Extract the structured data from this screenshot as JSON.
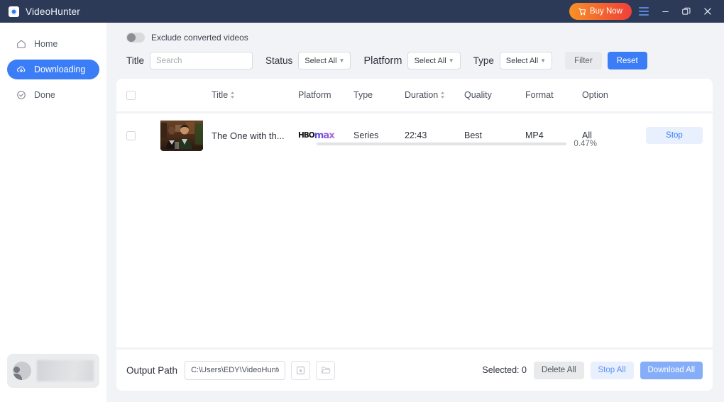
{
  "titlebar": {
    "app_name": "VideoHunter",
    "logo_icon": "videohunter-logo-icon",
    "buy_now_label": "Buy Now",
    "cart_icon": "shopping-cart-icon",
    "menu_icon": "hamburger-menu-icon",
    "minimize_icon": "minimize-icon",
    "maximize_icon": "maximize-restore-icon",
    "close_icon": "close-icon",
    "bg_color": "#2c3a57",
    "buy_now_gradient_from": "#f79127",
    "buy_now_gradient_to": "#ef3f3a"
  },
  "sidebar": {
    "items": [
      {
        "label": "Home",
        "icon": "home-icon",
        "active": false
      },
      {
        "label": "Downloading",
        "icon": "download-cloud-icon",
        "active": true
      },
      {
        "label": "Done",
        "icon": "check-circle-icon",
        "active": false
      }
    ],
    "active_color": "#3b7df6",
    "account": {
      "avatar_icon": "user-avatar-icon",
      "name_redacted": true
    }
  },
  "toolbar": {
    "exclude_toggle_label": "Exclude converted videos",
    "exclude_toggle_on": false,
    "title_label": "Title",
    "search_placeholder": "Search",
    "search_value": "",
    "status_label": "Status",
    "status_value": "Select All",
    "platform_label": "Platform",
    "platform_value": "Select All",
    "type_label": "Type",
    "type_value": "Select All",
    "filter_label": "Filter",
    "reset_label": "Reset",
    "reset_color": "#3b7df6"
  },
  "table": {
    "headers": {
      "title": "Title",
      "platform": "Platform",
      "type": "Type",
      "duration": "Duration",
      "quality": "Quality",
      "format": "Format",
      "option": "Option"
    },
    "sortable_columns": [
      "Title",
      "Duration"
    ],
    "select_all_checked": false,
    "rows": [
      {
        "checked": false,
        "thumbnail_alt": "friends-episode-thumbnail",
        "title": "The One with th...",
        "platform": "HBO max",
        "platform_brand_prefix": "HBO",
        "platform_brand_suffix": "max",
        "type": "Series",
        "duration": "22:43",
        "quality": "Best",
        "format": "MP4",
        "option": "All",
        "progress_percent": "0.47%",
        "progress_value": 0.47,
        "action_label": "Stop"
      }
    ]
  },
  "bottom": {
    "output_path_label": "Output Path",
    "output_path_value": "C:\\Users\\EDY\\VideoHunter",
    "select_folder_icon": "cursor-select-icon",
    "open_folder_icon": "folder-open-icon",
    "selected_text": "Selected: 0",
    "delete_all_label": "Delete All",
    "stop_all_label": "Stop All",
    "download_all_label": "Download All"
  }
}
